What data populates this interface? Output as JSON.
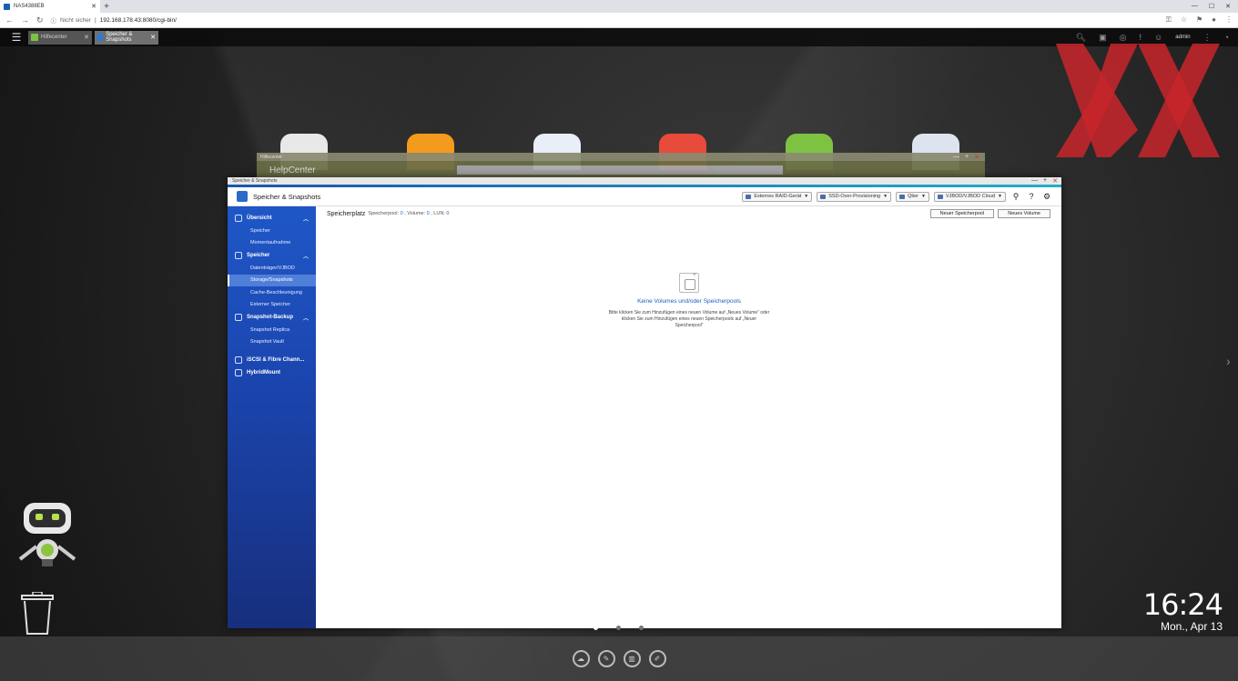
{
  "browser": {
    "tab_title": "NAS4388EB",
    "new_tab": "+",
    "security": "Nicht sicher",
    "url": "192.168.178.43:8080/cgi-bin/"
  },
  "qts": {
    "tabs": [
      {
        "label": "Hilfecenter"
      },
      {
        "label": "Speicher & Snapshots"
      }
    ],
    "user": "admin"
  },
  "helpcenter": {
    "window_title": "Hilfecenter",
    "heading": "HelpCenter"
  },
  "app": {
    "window_title": "Speicher & Snapshots",
    "title": "Speicher & Snapshots",
    "toolbar": {
      "external_raid": "Externes RAID-Gerät",
      "ssd_over": "SSD-Over-Provisioning",
      "qtier": "Qtier",
      "vjbod": "VJBOD/VJBOD Cloud"
    },
    "sidebar": {
      "groups": [
        {
          "label": "Übersicht",
          "items": [
            "Speicher",
            "Momentaufnahme"
          ]
        },
        {
          "label": "Speicher",
          "items": [
            "Datenträger/VJBOD",
            "Storage/Snapshots",
            "Cache-Beschleunigung",
            "Externer Speicher"
          ]
        },
        {
          "label": "Snapshot-Backup",
          "items": [
            "Snapshot Replica",
            "Snapshot Vault"
          ]
        },
        {
          "label": "iSCSI & Fibre Chann..."
        },
        {
          "label": "HybridMount"
        }
      ]
    },
    "content": {
      "heading": "Speicherplatz",
      "pool_label": "Speicherpool:",
      "pool_count": "0",
      "volume_label": ", Volume:",
      "volume_count": "0",
      "lun_label": ", LUN:",
      "lun_count": "0",
      "new_pool_button": "Neuer Speicherpool",
      "new_volume_button": "Neues Volume",
      "empty_title": "Keine Volumes und/oder Speicherpools",
      "empty_desc": "Bitte klicken Sie zum Hinzufügen eines neuen Volume auf „Neues Volume“ oder klicken Sie zum Hinzufügen eines neuen Speicherpools auf „Neuer Speicherpool“"
    }
  },
  "desktop": {
    "time": "16:24",
    "date": "Mon., Apr 13"
  }
}
